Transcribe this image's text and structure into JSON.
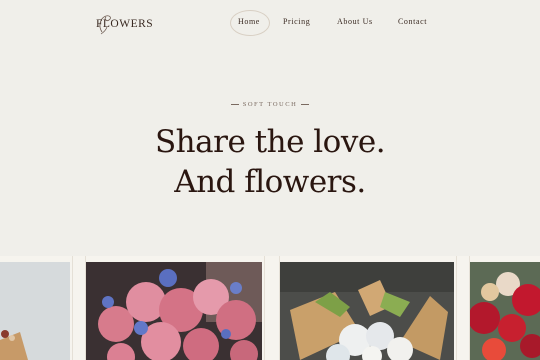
{
  "brand": {
    "logo_text": "LOWERS",
    "logo_initial": "F"
  },
  "nav": {
    "items": [
      {
        "label": "Home",
        "active": true
      },
      {
        "label": "Pricing",
        "active": false
      },
      {
        "label": "About Us",
        "active": false
      },
      {
        "label": "Contact",
        "active": false
      }
    ]
  },
  "hero": {
    "eyebrow": "SOFT TOUCH",
    "headline_line1": "Share the love.",
    "headline_line2": "And flowers."
  },
  "colors": {
    "background": "#f0efea",
    "text": "#2a1610",
    "accent_pink": "#d97f8f",
    "accent_red": "#b3182c",
    "kraft": "#c9a06a"
  },
  "gallery": {
    "images": [
      {
        "name": "bouquet-partial-left"
      },
      {
        "name": "pink-peony-bouquet"
      },
      {
        "name": "white-bouquet-kraft-paper"
      },
      {
        "name": "red-rose-bouquet"
      }
    ]
  }
}
